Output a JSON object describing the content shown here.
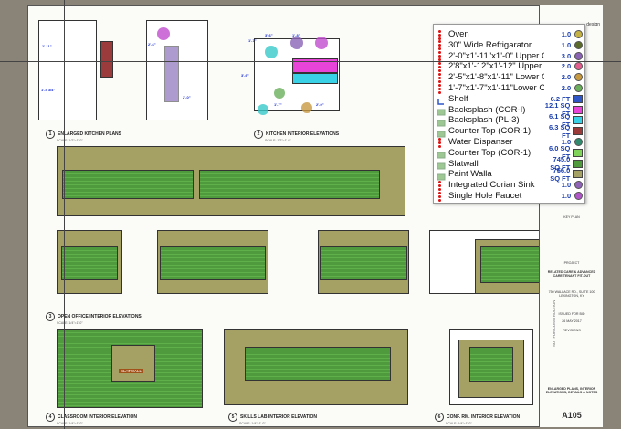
{
  "legend": {
    "items": [
      {
        "label": "Oven",
        "qty": "1.0",
        "icon": "count-dots-icon",
        "swatch": "#c4b244",
        "shape": "dot"
      },
      {
        "label": "30\" Wide  Refrigarator",
        "qty": "1.0",
        "icon": "count-dots-icon",
        "swatch": "#5a6b2a",
        "shape": "dot"
      },
      {
        "label": "2'-0\"x1'-11\"x1'-0\" Upper C...",
        "qty": "3.0",
        "icon": "count-dots-icon",
        "swatch": "#8a63b5",
        "shape": "dot"
      },
      {
        "label": "2'8\"x1'-12\"x1'-12\" Upper C...",
        "qty": "2.0",
        "icon": "count-dots-icon",
        "swatch": "#e05d8e",
        "shape": "dot"
      },
      {
        "label": "2'-5\"x1'-8\"x1'-11\" Lower C...",
        "qty": "2.0",
        "icon": "count-dots-icon",
        "swatch": "#c79a42",
        "shape": "dot"
      },
      {
        "label": "1'-7\"x1'-7\"x1'-11\"Lower C...",
        "qty": "2.0",
        "icon": "count-dots-icon",
        "swatch": "#6aaf5c",
        "shape": "dot"
      },
      {
        "label": "Shelf",
        "qty": "6.2 FT",
        "icon": "linear-measure-icon",
        "swatch": "#2f56c9",
        "shape": "square"
      },
      {
        "label": "Backsplash (COR-I)",
        "qty": "12.1 SQ FT",
        "icon": "area-measure-icon",
        "swatch": "#e944d8",
        "shape": "square"
      },
      {
        "label": "Backsplash (PL-3)",
        "qty": "6.1 SQ FT",
        "icon": "area-measure-icon",
        "swatch": "#38d1e6",
        "shape": "square"
      },
      {
        "label": "Counter Top (COR-1)",
        "qty": "6.3 SQ FT",
        "icon": "area-measure-icon",
        "swatch": "#9c3a3a",
        "shape": "square"
      },
      {
        "label": "Water Dispanser",
        "qty": "1.0",
        "icon": "count-dots-icon",
        "swatch": "#2f8a6e",
        "shape": "dot"
      },
      {
        "label": "Counter Top (COR-1)",
        "qty": "6.0 SQ FT",
        "icon": "area-measure-icon",
        "swatch": "#7fd35a",
        "shape": "square"
      },
      {
        "label": "Slatwall",
        "qty": "745.0 SQ FT",
        "icon": "area-measure-icon",
        "swatch": "#4e9a3c",
        "shape": "square"
      },
      {
        "label": "Paint Walla",
        "qty": "756.0 SQ FT",
        "icon": "area-measure-icon",
        "swatch": "#a5a165",
        "shape": "square"
      },
      {
        "label": "Integrated Corian Sink",
        "qty": "1.0",
        "icon": "count-dots-icon",
        "swatch": "#8e63b8",
        "shape": "dot"
      },
      {
        "label": "Single Hole Faucet",
        "qty": "1.0",
        "icon": "count-dots-icon",
        "swatch": "#b055c8",
        "shape": "dot"
      }
    ]
  },
  "drawings": [
    {
      "num": "1",
      "title": "ENLARGED KITCHEN PLANS",
      "scale": "SCALE: 1/2\"=1'-0\""
    },
    {
      "num": "2",
      "title": "KITCHEN INTERIOR ELEVATIONS",
      "scale": "SCALE: 1/2\"=1'-0\""
    },
    {
      "num": "3",
      "title": "OPEN OFFICE INTERIOR ELEVATIONS",
      "scale": "SCALE: 1/4\"=1'-0\""
    },
    {
      "num": "4",
      "title": "CLASSROOM INTERIOR ELEVATION",
      "scale": "SCALE: 1/4\"=1'-0\""
    },
    {
      "num": "5",
      "title": "SKILLS LAB INTERIOR ELEVATION",
      "scale": "SCALE: 1/4\"=1'-0\""
    },
    {
      "num": "6",
      "title": "CONF. RM. INTERIOR ELEVATION",
      "scale": "SCALE: 1/4\"=1'-0\""
    }
  ],
  "dimensions": {
    "d1": "1'-11\"",
    "d2": "1'-5 3/4\"",
    "d3": "2'-6\"",
    "d4": "2'-0\"",
    "d5": "1'-7\"",
    "d6": "3'-6\"",
    "d7": "1'-8\"",
    "d8": "3'-6\"",
    "d9": "1'-7\"",
    "d10": "2'-0\""
  },
  "classroom_label": "SLATWALL",
  "titleblock": {
    "firm": "design",
    "stamp": "NOT FOR CONSTRUCTION",
    "key_plan": "KEY PLAN",
    "project_label": "PROJECT",
    "project_name": "RELATED CARE & ADVANCED CARE TENANT FIT-OUT",
    "address": "750 WALLACE RD., SUITE 100 LEXINGTON, KY",
    "submittal": "ISSUED FOR BID",
    "date": "26 MAY 2017",
    "revisions": "REVISIONS",
    "sheet_title": "ENLARGED PLANS, INTERIOR ELEVATIONS, DETAILS & NOTES",
    "sheet_number": "A105"
  },
  "colors": {
    "slatwall": "#4e9a3c",
    "paint": "#a5a165",
    "count_dot": "#dd1111"
  }
}
